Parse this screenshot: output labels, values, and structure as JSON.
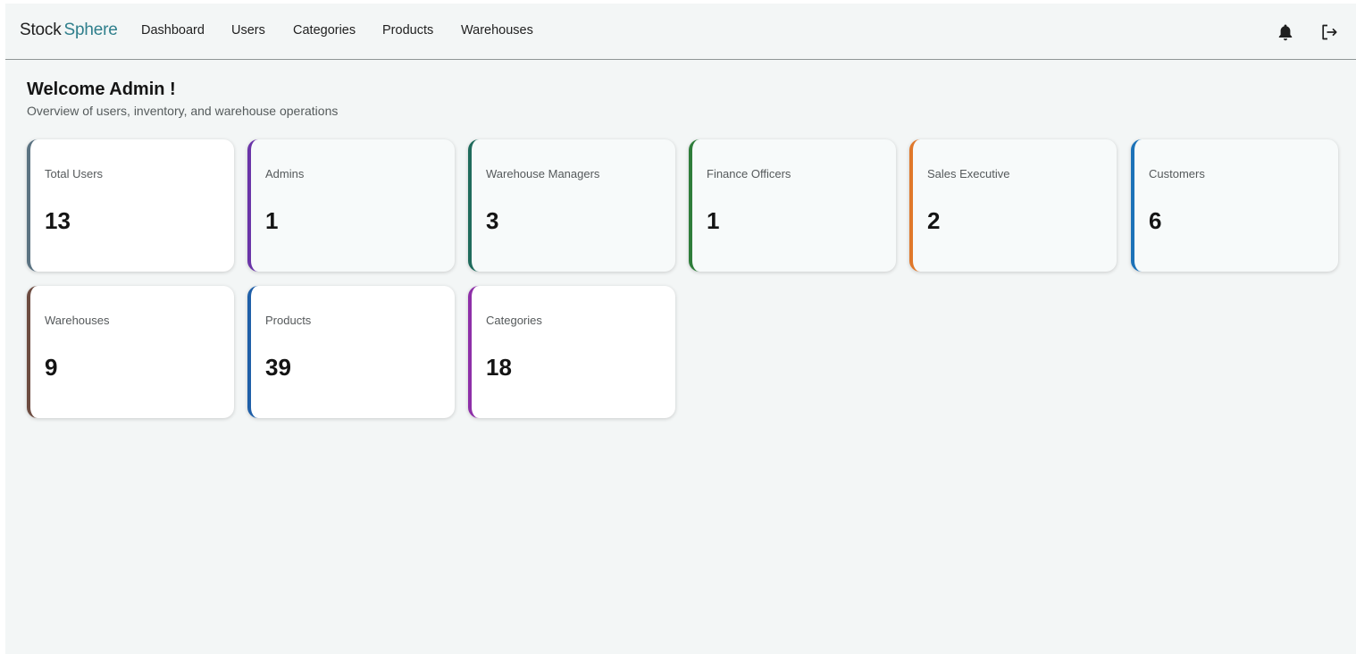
{
  "brand": {
    "part1": "Stock",
    "part2": "Sphere"
  },
  "nav": {
    "items": [
      {
        "label": "Dashboard"
      },
      {
        "label": "Users"
      },
      {
        "label": "Categories"
      },
      {
        "label": "Products"
      },
      {
        "label": "Warehouses"
      }
    ]
  },
  "header_icons": [
    "bell-icon",
    "logout-icon"
  ],
  "page": {
    "title": "Welcome Admin !",
    "subtitle": "Overview of users, inventory, and warehouse operations"
  },
  "stats": [
    {
      "label": "Total Users",
      "value": "13",
      "accent": "#5b7382"
    },
    {
      "label": "Admins",
      "value": "1",
      "accent": "#6a34a8"
    },
    {
      "label": "Warehouse Managers",
      "value": "3",
      "accent": "#1f6b5c"
    },
    {
      "label": "Finance Officers",
      "value": "1",
      "accent": "#2e7d3a"
    },
    {
      "label": "Sales Executive",
      "value": "2",
      "accent": "#e0782a"
    },
    {
      "label": "Customers",
      "value": "6",
      "accent": "#1c72b8"
    },
    {
      "label": "Warehouses",
      "value": "9",
      "accent": "#6d4c41"
    },
    {
      "label": "Products",
      "value": "39",
      "accent": "#1f5fa8"
    },
    {
      "label": "Categories",
      "value": "18",
      "accent": "#8e2fa8"
    }
  ]
}
